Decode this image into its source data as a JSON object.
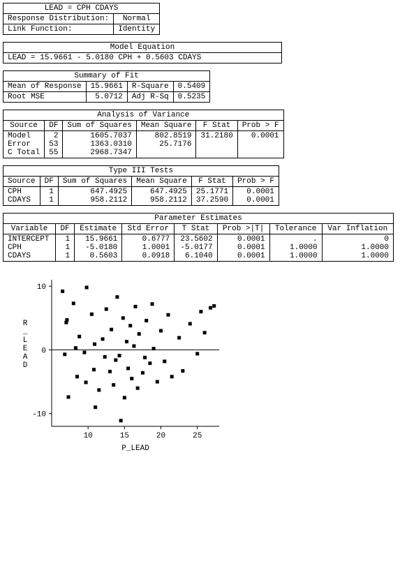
{
  "header": {
    "line1": "LEAD   =   CPH   CDAYS",
    "dist_label": "Response Distribution:",
    "dist_value": "Normal",
    "link_label": "Link Function:",
    "link_value": "Identity"
  },
  "model_eq": {
    "title": "Model Equation",
    "text": "LEAD   =   15.9661   -    5.0180  CPH   +    0.5603  CDAYS"
  },
  "summary": {
    "title": "Summary of Fit",
    "l1a": "Mean of Response",
    "l1b": "15.9661",
    "l1c": "R-Square",
    "l1d": "0.5409",
    "l2a": "Root MSE",
    "l2b": "5.0712",
    "l2c": "Adj R-Sq",
    "l2d": "0.5235"
  },
  "anova": {
    "title": "Analysis of Variance",
    "cols": [
      "Source",
      "DF",
      "Sum of Squares",
      "Mean Square",
      "F Stat",
      "Prob > F"
    ],
    "rows": [
      [
        "Model",
        "2",
        "1605.7037",
        "802.8519",
        "31.2180",
        "0.0001"
      ],
      [
        "Error",
        "53",
        "1363.0310",
        "25.7176",
        "",
        ""
      ],
      [
        "C Total",
        "55",
        "2968.7347",
        "",
        "",
        ""
      ]
    ]
  },
  "type3": {
    "title": "Type III Tests",
    "cols": [
      "Source",
      "DF",
      "Sum of Squares",
      "Mean Square",
      "F Stat",
      "Prob > F"
    ],
    "rows": [
      [
        "CPH",
        "1",
        "647.4925",
        "647.4925",
        "25.1771",
        "0.0001"
      ],
      [
        "CDAYS",
        "1",
        "958.2112",
        "958.2112",
        "37.2590",
        "0.0001"
      ]
    ]
  },
  "params": {
    "title": "Parameter Estimates",
    "cols": [
      "Variable",
      "DF",
      "Estimate",
      "Std Error",
      "T Stat",
      "Prob >|T|",
      "Tolerance",
      "Var Inflation"
    ],
    "rows": [
      [
        "INTERCEPT",
        "1",
        "15.9661",
        "0.6777",
        "23.5602",
        "0.0001",
        ".",
        "0"
      ],
      [
        "CPH",
        "1",
        "-5.0180",
        "1.0001",
        "-5.0177",
        "0.0001",
        "1.0000",
        "1.0000"
      ],
      [
        "CDAYS",
        "1",
        "0.5603",
        "0.0918",
        "6.1040",
        "0.0001",
        "1.0000",
        "1.0000"
      ]
    ]
  },
  "chart_data": {
    "type": "scatter",
    "xlabel": "P_LEAD",
    "ylabel": "R_LEAD",
    "xlim": [
      5,
      28
    ],
    "ylim": [
      -12,
      11
    ],
    "xticks": [
      10,
      15,
      20,
      25
    ],
    "yticks": [
      -10,
      0,
      10
    ],
    "points": [
      [
        6.5,
        9.2
      ],
      [
        6.8,
        -0.7
      ],
      [
        7.0,
        4.3
      ],
      [
        7.1,
        4.7
      ],
      [
        7.3,
        -7.4
      ],
      [
        8.0,
        7.3
      ],
      [
        8.3,
        0.3
      ],
      [
        8.5,
        -4.2
      ],
      [
        8.8,
        2.1
      ],
      [
        9.5,
        -0.4
      ],
      [
        9.7,
        -5.1
      ],
      [
        9.8,
        9.8
      ],
      [
        10.5,
        5.6
      ],
      [
        10.8,
        -3.1
      ],
      [
        10.9,
        0.9
      ],
      [
        11.0,
        -9.0
      ],
      [
        11.5,
        -6.3
      ],
      [
        12.0,
        1.7
      ],
      [
        12.3,
        -1.1
      ],
      [
        12.5,
        6.4
      ],
      [
        13.0,
        -3.4
      ],
      [
        13.2,
        3.2
      ],
      [
        13.5,
        -5.5
      ],
      [
        13.8,
        -1.6
      ],
      [
        14.0,
        8.3
      ],
      [
        14.3,
        -0.9
      ],
      [
        14.5,
        -11.1
      ],
      [
        14.8,
        5.0
      ],
      [
        15.0,
        -7.5
      ],
      [
        15.3,
        1.3
      ],
      [
        15.5,
        -2.9
      ],
      [
        15.8,
        3.8
      ],
      [
        16.0,
        -4.5
      ],
      [
        16.3,
        0.6
      ],
      [
        16.5,
        6.8
      ],
      [
        16.8,
        -6.0
      ],
      [
        17.0,
        2.5
      ],
      [
        17.5,
        -3.6
      ],
      [
        17.8,
        -1.2
      ],
      [
        18.0,
        4.6
      ],
      [
        18.5,
        -2.1
      ],
      [
        18.8,
        7.2
      ],
      [
        19.0,
        0.2
      ],
      [
        19.5,
        -5.0
      ],
      [
        20.0,
        3.0
      ],
      [
        20.5,
        -1.8
      ],
      [
        21.0,
        5.5
      ],
      [
        21.5,
        -4.2
      ],
      [
        22.5,
        1.9
      ],
      [
        23.0,
        -3.3
      ],
      [
        24.0,
        4.1
      ],
      [
        25.0,
        -0.6
      ],
      [
        25.5,
        6.0
      ],
      [
        26.0,
        2.7
      ],
      [
        26.8,
        6.6
      ],
      [
        27.3,
        6.9
      ]
    ]
  }
}
